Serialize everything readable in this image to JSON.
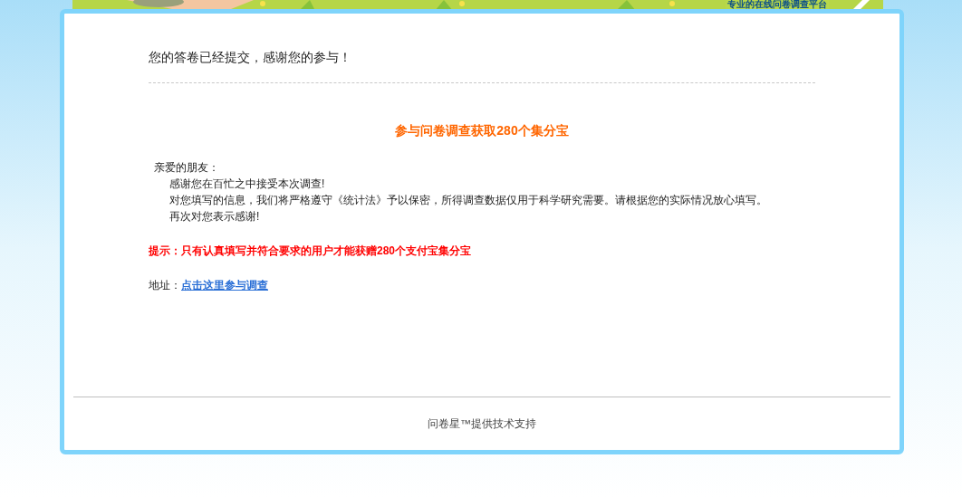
{
  "banner": {
    "slogan": "专业的在线问卷调查平台"
  },
  "notice": "您的答卷已经提交，感谢您的参与！",
  "headline": "参与问卷调查获取280个集分宝",
  "greeting": "亲爱的朋友：",
  "paragraphs": [
    "感谢您在百忙之中接受本次调查!",
    "对您填写的信息，我们将严格遵守《统计法》予以保密，所得调查数据仅用于科学研究需要。请根据您的实际情况放心填写。",
    "再次对您表示感谢!"
  ],
  "tip": "提示：只有认真填写并符合要求的用户才能获赠280个支付宝集分宝",
  "address": {
    "label": "地址：",
    "link": "点击这里参与调查"
  },
  "footer": "问卷星™提供技术支持"
}
